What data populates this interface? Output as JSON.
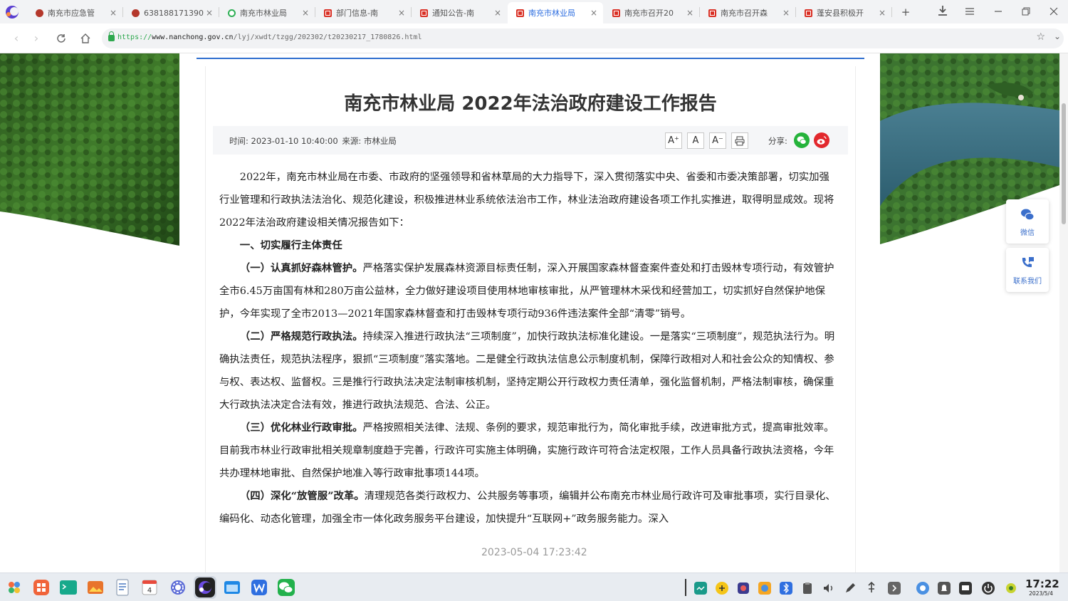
{
  "browser": {
    "tabs": [
      {
        "title": "南充市应急管",
        "favicon": "seal"
      },
      {
        "title": "638188171390",
        "favicon": "seal"
      },
      {
        "title": "南充市林业局",
        "favicon": "q"
      },
      {
        "title": "部门信息-南",
        "favicon": "gov"
      },
      {
        "title": "通知公告-南",
        "favicon": "gov"
      },
      {
        "title": "南充市林业局",
        "favicon": "gov",
        "active": true
      },
      {
        "title": "南充市召开20",
        "favicon": "gov"
      },
      {
        "title": "南充市召开森",
        "favicon": "gov"
      },
      {
        "title": "蓬安县积极开",
        "favicon": "gov"
      }
    ],
    "tab_close_glyph": "×",
    "new_tab_glyph": "+",
    "url": {
      "protocol": "https://",
      "host": "www.nanchong.gov.cn",
      "path": "/lyj/xwdt/tzgg/202302/t20230217_1780826.html"
    },
    "accent_color": "#2f6fe0"
  },
  "article": {
    "title": "南充市林业局 2022年法治政府建设工作报告",
    "meta": {
      "time_label": "时间:",
      "time": "2023-01-10 10:40:00",
      "source_label": "来源:",
      "source": "市林业局",
      "font_buttons": [
        "A⁺",
        "A",
        "A⁻"
      ],
      "share_label": "分享:"
    },
    "paragraphs": [
      "2022年，南充市林业局在市委、市政府的坚强领导和省林草局的大力指导下，深入贯彻落实中央、省委和市委决策部署，切实加强行业管理和行政执法法治化、规范化建设，积极推进林业系统依法治市工作，林业法治政府建设各项工作扎实推进，取得明显成效。现将2022年法治政府建设相关情况报告如下：",
      "一、切实履行主体责任",
      {
        "lead": "（一）认真抓好森林管护。",
        "text": "严格落实保护发展森林资源目标责任制，深入开展国家森林督查案件查处和打击毁林专项行动，有效管护全市6.45万亩国有林和280万亩公益林，全力做好建设项目使用林地审核审批，从严管理林木采伐和经营加工，切实抓好自然保护地保护，今年实现了全市2013—2021年国家森林督查和打击毁林专项行动936件违法案件全部“清零”销号。"
      },
      {
        "lead": "（二）严格规范行政执法。",
        "text": "持续深入推进行政执法“三项制度”，加快行政执法标准化建设。一是落实“三项制度”，规范执法行为。明确执法责任，规范执法程序，狠抓“三项制度”落实落地。二是健全行政执法信息公示制度机制，保障行政相对人和社会公众的知情权、参与权、表达权、监督权。三是推行行政执法决定法制审核机制，坚持定期公开行政权力责任清单，强化监督机制，严格法制审核，确保重大行政执法决定合法有效，推进行政执法规范、合法、公正。"
      },
      {
        "lead": "（三）优化林业行政审批。",
        "text": "严格按照相关法律、法规、条例的要求，规范审批行为，简化审批手续，改进审批方式，提高审批效率。目前我市林业行政审批相关规章制度趋于完善，行政许可实施主体明确，实施行政许可符合法定权限，工作人员具备行政执法资格，今年共办理林地审批、自然保护地准入等行政审批事项144项。"
      },
      {
        "lead": "（四）深化“放管服”改革。",
        "text": "清理规范各类行政权力、公共服务等事项，编辑并公布南充市林业局行政许可及审批事项，实行目录化、编码化、动态化管理，加强全市一体化政务服务平台建设，加快提升“互联网+”政务服务能力。深入"
      }
    ]
  },
  "side_widgets": {
    "wechat_label": "微信",
    "contact_label": "联系我们"
  },
  "watermark": "2023-05-04 17:23:42",
  "taskbar": {
    "clock_time": "17:22",
    "clock_date": "2023/5/4",
    "calendar_day": "4"
  }
}
